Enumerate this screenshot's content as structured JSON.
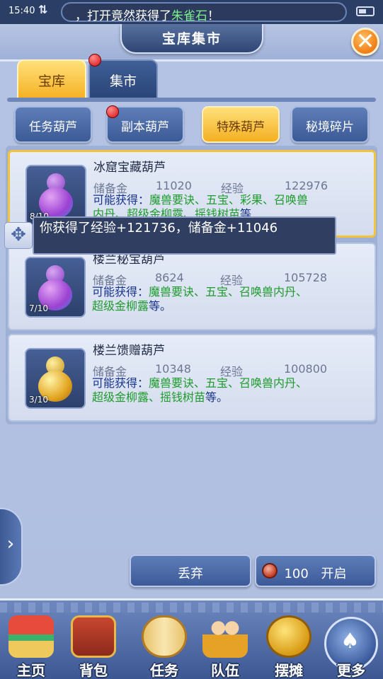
{
  "status": {
    "time": "15:40",
    "notice_prefix": "，打开竟然获得了",
    "notice_item": "朱雀石",
    "notice_suffix": "！"
  },
  "header": {
    "title": "宝库集市",
    "close": "✕"
  },
  "tabs": [
    {
      "label": "宝库"
    },
    {
      "label": "集市"
    }
  ],
  "categories": [
    {
      "label": "任务葫芦"
    },
    {
      "label": "副本葫芦"
    },
    {
      "label": "特殊葫芦"
    },
    {
      "label": "秘境碎片"
    }
  ],
  "items": [
    {
      "name": "冰窟宝藏葫芦",
      "reserve_label": "储备金",
      "reserve": "11020",
      "exp_label": "经验",
      "exp": "122976",
      "desc_prefix": "可能获得：",
      "desc_line1": "魔兽要诀、五宝、彩果、召唤兽",
      "desc_line2": "内丹、超级金柳露、摇钱树苗",
      "desc_suffix": "等",
      "count": "8/10"
    },
    {
      "name": "楼兰秘宝葫芦",
      "reserve_label": "储备金",
      "reserve": "8624",
      "exp_label": "经验",
      "exp": "105728",
      "desc_prefix": "可能获得：",
      "desc_line1": "魔兽要诀、五宝、召唤兽内丹、",
      "desc_line2": "超级金柳露",
      "desc_suffix": "等。",
      "count": "7/10"
    },
    {
      "name": "楼兰馈赠葫芦",
      "reserve_label": "储备金",
      "reserve": "10348",
      "exp_label": "经验",
      "exp": "100800",
      "desc_prefix": "可能获得：",
      "desc_line1": "魔兽要诀、五宝、召唤兽内丹、",
      "desc_line2": "超级金柳露、摇钱树苗",
      "desc_suffix": "等。",
      "count": "3/10"
    }
  ],
  "tooltip": {
    "text": "你获得了经验+121736，储备金+11046"
  },
  "actions": {
    "discard": "丢弃",
    "open_cost": "100",
    "open": "开启"
  },
  "nav": [
    {
      "label": "主页"
    },
    {
      "label": "背包"
    },
    {
      "label": "任务"
    },
    {
      "label": "队伍"
    },
    {
      "label": "摆摊"
    },
    {
      "label": "更多"
    }
  ],
  "colors": {
    "accent_gold": "#f5b225",
    "panel_blue": "#3c5a98",
    "highlight_green": "#1f9b2e",
    "notice_green": "#7cf08d"
  }
}
